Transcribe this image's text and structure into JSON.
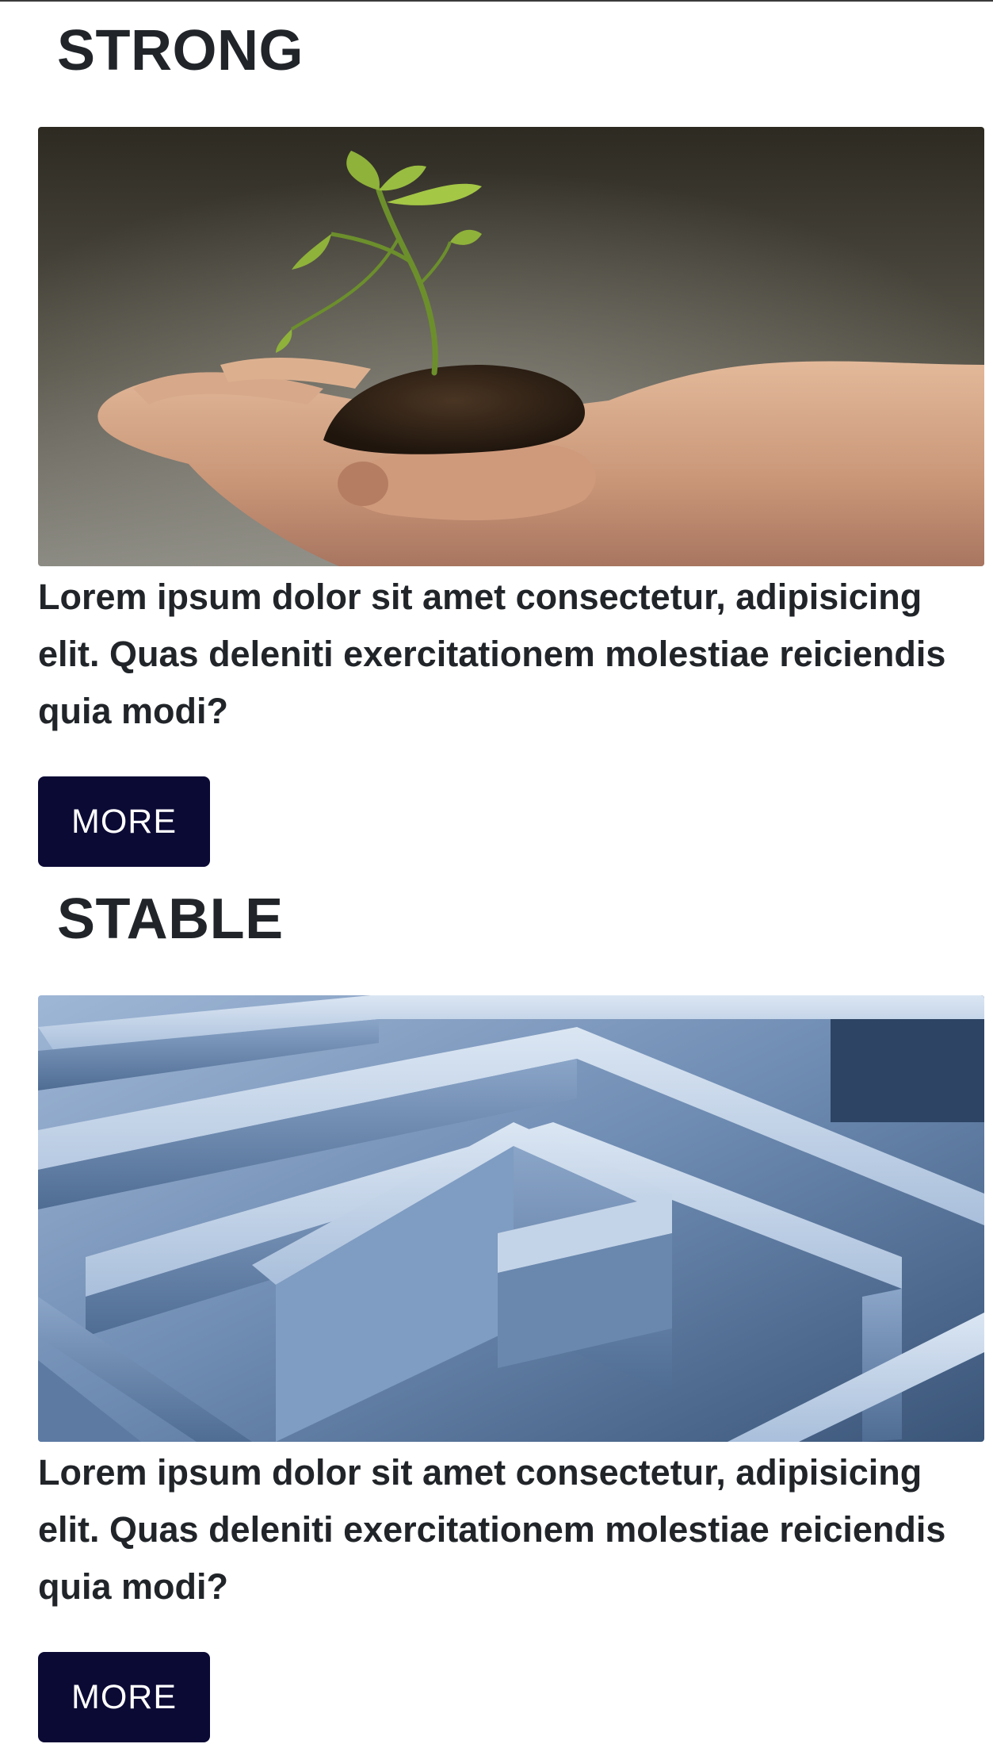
{
  "cards": [
    {
      "title": "STRONG",
      "image_alt": "hand-holding-seedling",
      "text": "Lorem ipsum dolor sit amet consectetur, adipisicing elit. Quas deleniti exercitationem molestiae reiciendis quia modi?",
      "button_label": "MORE"
    },
    {
      "title": "STABLE",
      "image_alt": "blue-maze",
      "text": "Lorem ipsum dolor sit amet consectetur, adipisicing elit. Quas deleniti exercitationem molestiae reiciendis quia modi?",
      "button_label": "MORE"
    }
  ],
  "colors": {
    "button_bg": "#0b0a35",
    "button_text": "#ffffff",
    "text": "#212529"
  }
}
